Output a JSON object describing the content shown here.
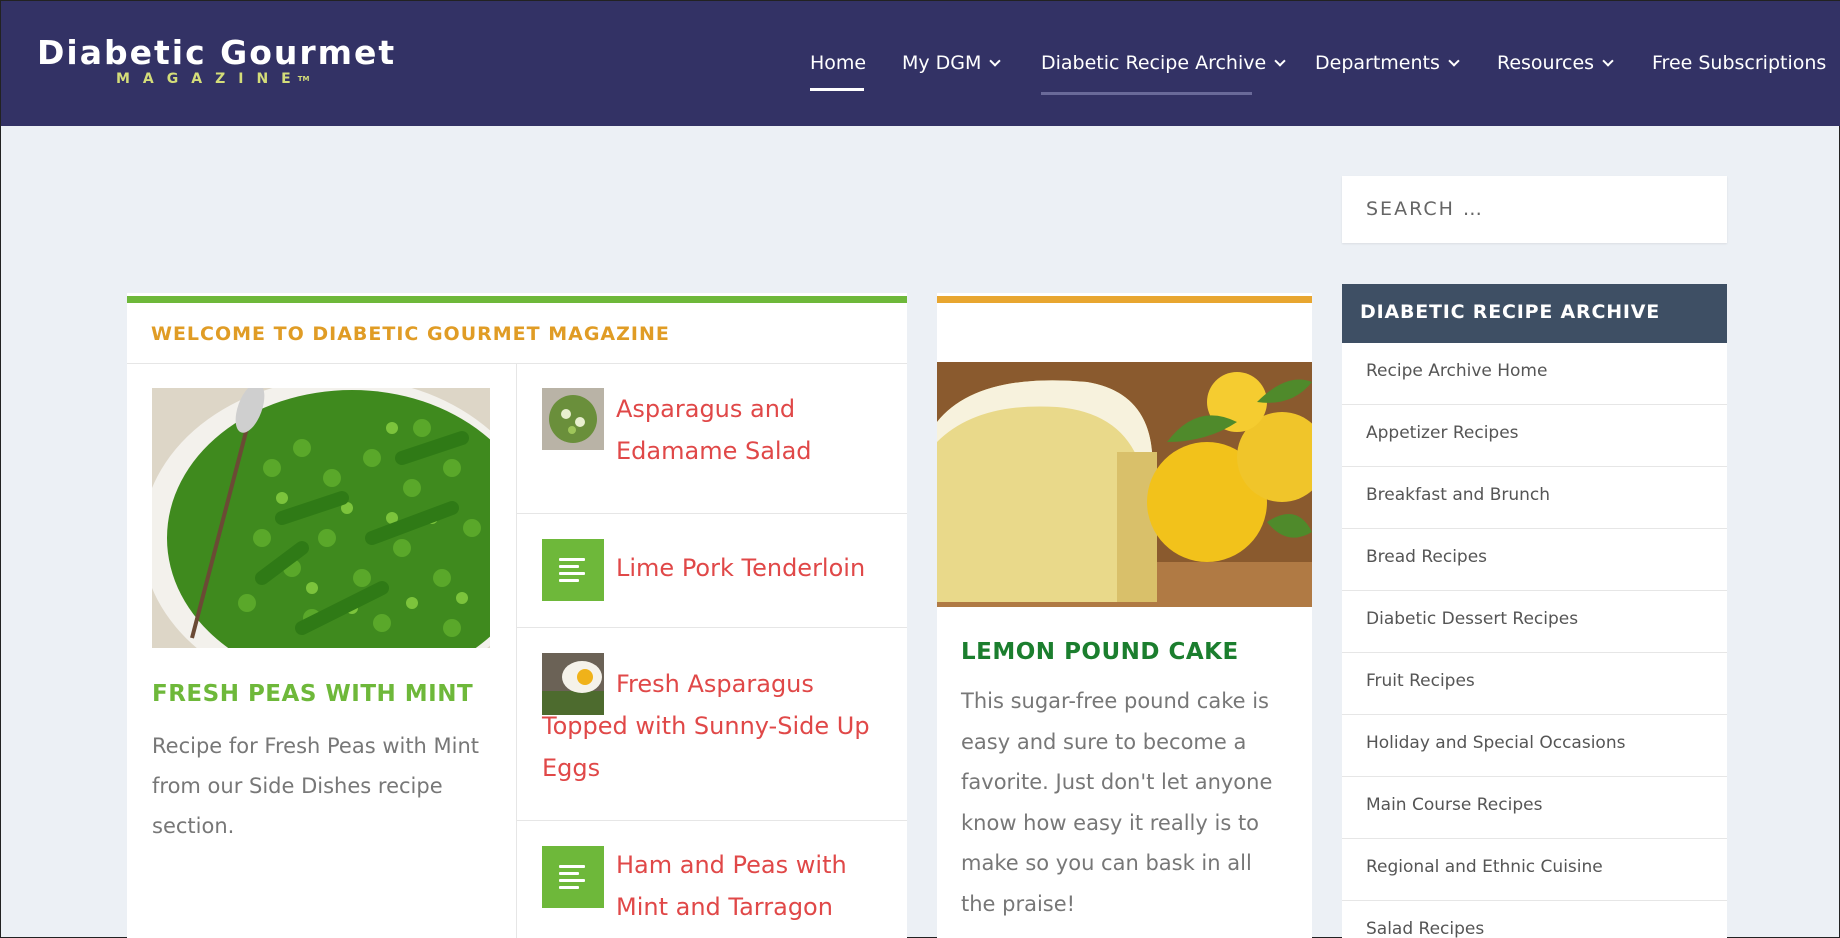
{
  "brand": {
    "logo_main": "Diabetic Gourmet",
    "logo_sub": "MAGAZINE",
    "logo_tm": "TM"
  },
  "nav": {
    "items": [
      {
        "label": "Home",
        "has_dropdown": false,
        "active": true
      },
      {
        "label": "My DGM",
        "has_dropdown": true
      },
      {
        "label": "Diabetic Recipe Archive",
        "has_dropdown": true
      },
      {
        "label": "Departments",
        "has_dropdown": true
      },
      {
        "label": "Resources",
        "has_dropdown": true
      },
      {
        "label": "Free Subscriptions",
        "has_dropdown": false
      }
    ]
  },
  "main": {
    "section_title": "WELCOME TO DIABETIC GOURMET MAGAZINE",
    "featured": {
      "title": "FRESH PEAS WITH MINT",
      "text": "Recipe for Fresh Peas with Mint from our Side Dishes recipe section."
    },
    "list": [
      {
        "title": "Asparagus and Edamame Salad",
        "thumb": "photo"
      },
      {
        "title": "Lime Pork Tenderloin",
        "thumb": "document-icon"
      },
      {
        "title": "Fresh Asparagus Topped with Sunny-Side Up Eggs",
        "thumb": "photo"
      },
      {
        "title": "Ham and Peas with Mint and Tarragon",
        "thumb": "document-icon"
      }
    ]
  },
  "mid": {
    "title": "LEMON POUND CAKE",
    "text": "This sugar-free pound cake is easy and sure to become a favorite. Just don't let anyone know how easy it really is to make so you can bask in all the praise!"
  },
  "sidebar": {
    "search_placeholder": "SEARCH …",
    "archive_title": "DIABETIC RECIPE ARCHIVE",
    "items": [
      "Recipe Archive Home",
      "Appetizer Recipes",
      "Breakfast and Brunch",
      "Bread Recipes",
      "Diabetic Dessert Recipes",
      "Fruit Recipes",
      "Holiday and Special Occasions",
      "Main Course Recipes",
      "Regional and Ethnic Cuisine",
      "Salad Recipes"
    ]
  },
  "colors": {
    "header_bg": "#333265",
    "page_bg": "#ecf0f5",
    "green_accent": "#6eb83a",
    "orange_accent": "#e8a630",
    "link_red": "#e04848",
    "sidebar_head": "#3e4f64"
  }
}
